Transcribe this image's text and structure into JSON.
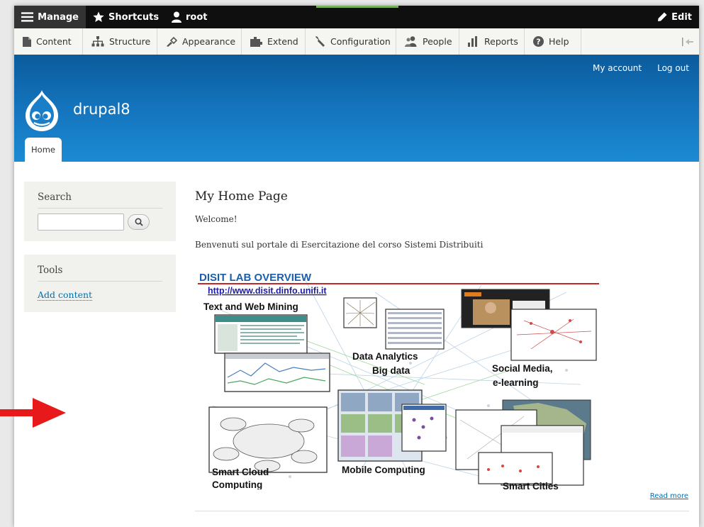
{
  "toolbar": {
    "manage": "Manage",
    "shortcuts": "Shortcuts",
    "user": "root",
    "edit": "Edit"
  },
  "tray": {
    "items": [
      {
        "label": "Content",
        "icon": "content-icon"
      },
      {
        "label": "Structure",
        "icon": "structure-icon"
      },
      {
        "label": "Appearance",
        "icon": "appearance-icon"
      },
      {
        "label": "Extend",
        "icon": "extend-icon"
      },
      {
        "label": "Configuration",
        "icon": "configuration-icon"
      },
      {
        "label": "People",
        "icon": "people-icon"
      },
      {
        "label": "Reports",
        "icon": "reports-icon"
      },
      {
        "label": "Help",
        "icon": "help-icon"
      }
    ]
  },
  "header": {
    "my_account": "My account",
    "log_out": "Log out",
    "site_name": "drupal8",
    "home_tab": "Home"
  },
  "sidebar": {
    "search_title": "Search",
    "search_value": "",
    "tools_title": "Tools",
    "add_content": "Add content"
  },
  "main": {
    "title": "My Home Page",
    "welcome": "Welcome!",
    "intro": "Benvenuti sul portale di Esercitazione del corso Sistemi Distribuiti",
    "read_more": "Read more"
  },
  "overview": {
    "title": "DISIT LAB OVERVIEW",
    "url": "http://www.disit.dinfo.unifi.it",
    "labels": {
      "text_mining": "Text and Web Mining",
      "data_analytics": "Data Analytics",
      "big_data": "Big data",
      "social_media": "Social Media,",
      "elearning": "e-learning",
      "smart_cloud": "Smart Cloud",
      "computing": "Computing",
      "mobile": "Mobile Computing",
      "smart_cities": "Smart Cities"
    }
  },
  "colors": {
    "header_blue": "#1474bd",
    "admin_black": "#0f0f0f",
    "link_blue": "#0071b3",
    "arrow_red": "#e8191a"
  }
}
